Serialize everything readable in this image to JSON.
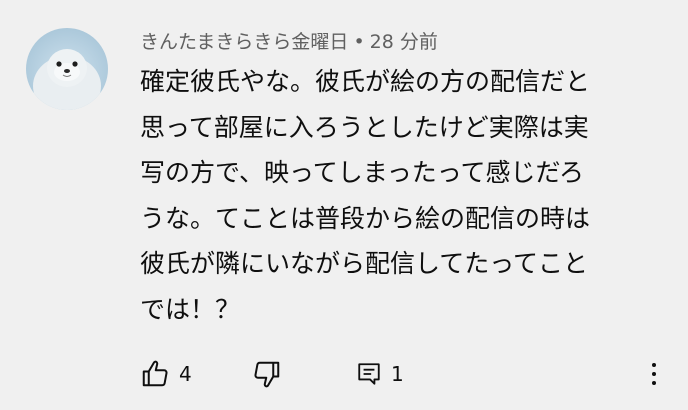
{
  "comment": {
    "author": "きんたまきらきら金曜日",
    "separator": "•",
    "time": "28 分前",
    "lines": [
      "確定彼氏やな。彼氏が絵の方の配信だと",
      "思って部屋に入ろうとしたけど実際は実",
      "写の方で、映ってしまったって感じだろ",
      "うな。てことは普段から絵の配信の時は",
      "彼氏が隣にいながら配信してたってこと",
      "では！？"
    ]
  },
  "actions": {
    "like_icon": "thumbs-up-icon",
    "like_count": "4",
    "dislike_icon": "thumbs-down-icon",
    "reply_icon": "comment-reply-icon",
    "reply_count": "1",
    "more_icon": "more-vertical-icon"
  },
  "colors": {
    "background": "#f0f0f0",
    "meta_text": "#606060",
    "body_text": "#0f0f0f"
  }
}
